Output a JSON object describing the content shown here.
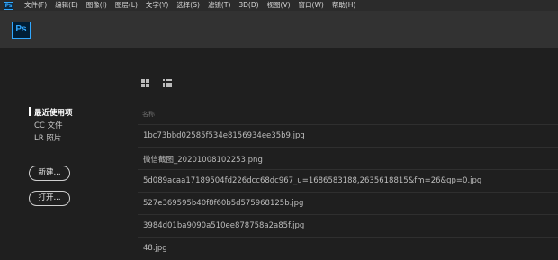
{
  "menubar": {
    "app_icon": "Ps",
    "items": [
      "文件(F)",
      "编辑(E)",
      "图像(I)",
      "图层(L)",
      "文字(Y)",
      "选择(S)",
      "滤镜(T)",
      "3D(D)",
      "视图(V)",
      "窗口(W)",
      "帮助(H)"
    ]
  },
  "header": {
    "logo": "Ps"
  },
  "sidebar": {
    "items": [
      {
        "label": "最近使用项",
        "active": true
      },
      {
        "label": "CC 文件",
        "active": false
      },
      {
        "label": "LR 照片",
        "active": false
      }
    ],
    "new_button": "新建...",
    "open_button": "打开..."
  },
  "view_toggle": {
    "grid": "grid-view-icon",
    "list": "list-view-icon"
  },
  "files": {
    "column_header": "名称",
    "rows": [
      "1bc73bbd02585f534e8156934ee35b9.jpg",
      "微信截图_20201008102253.png",
      "5d089acaa17189504fd226dcc68dc967_u=1686583188,2635618815&fm=26&gp=0.jpg",
      "527e369595b40f8f60b5d575968125b.jpg",
      "3984d01ba9090a510ee878758a2a85f.jpg",
      "48.jpg"
    ]
  },
  "colors": {
    "accent": "#31a8ff",
    "background": "#1f1f1f",
    "header": "#323232",
    "menubar": "#2b2b2b"
  }
}
